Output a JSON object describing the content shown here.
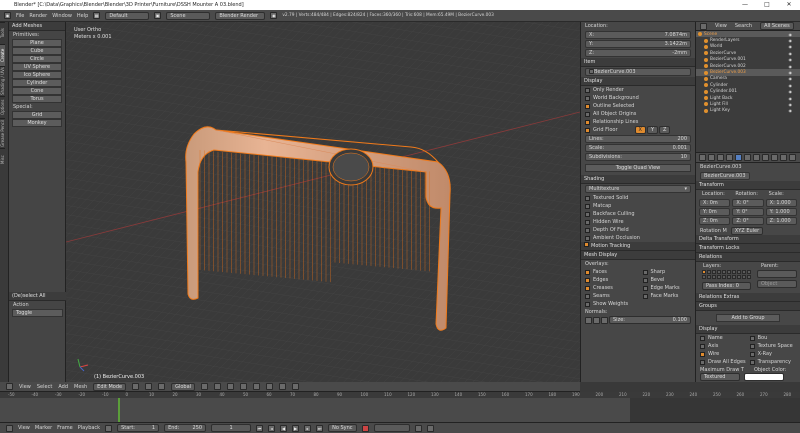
{
  "window": {
    "title": "Blender* [C:\\Data\\Graphics\\Blender\\Blender\\3D Printer\\Furniture\\DSSH Mounter A 03.blend]",
    "controls": [
      "—",
      "□",
      "✕"
    ]
  },
  "topmenu": {
    "items": [
      "File",
      "Render",
      "Window",
      "Help"
    ],
    "layout": "Default",
    "scene": "Scene",
    "engine": "Blender Render",
    "stats": "v2.79 | Verts:484/484 | Edges:824/824 | Faces:360/360 | Tris:608 | Mem:65.49M | BezierCurve.003"
  },
  "left_tabs": [
    "Tools",
    "Create",
    "Shading / UVs",
    "Options",
    "Grease Pencil",
    "Misc"
  ],
  "toolshelf": {
    "header": "Add Meshes",
    "section_primitives": "Primitives:",
    "primitives": [
      "Plane",
      "Cube",
      "Circle",
      "UV Sphere",
      "Ico Sphere",
      "Cylinder",
      "Cone",
      "Torus"
    ],
    "section_special": "Special:",
    "special": [
      "Grid",
      "Monkey"
    ],
    "op_header": "(De)select All",
    "op_action_label": "Action",
    "op_action_value": "Toggle"
  },
  "viewport": {
    "view_label": "User Ortho",
    "meters_label": "Meters x 0.001",
    "object_label": "(1) BezierCurve.003"
  },
  "properties_panel": {
    "location_label": "Location:",
    "location": [
      {
        "axis": "X:",
        "value": "7.0874m"
      },
      {
        "axis": "Y:",
        "value": "3.1422m"
      },
      {
        "axis": "Z:",
        "value": "-2mm"
      }
    ],
    "item_header": "Item",
    "item_name": "BezierCurve.003",
    "display_header": "Display",
    "display_options": [
      {
        "label": "Only Render",
        "checked": false
      },
      {
        "label": "World Background",
        "checked": false
      },
      {
        "label": "Outline Selected",
        "checked": true
      },
      {
        "label": "All Object Origins",
        "checked": false
      },
      {
        "label": "Relationship Lines",
        "checked": true
      }
    ],
    "grid_floor_label": "Grid Floor",
    "grid_axes": [
      "X",
      "Y",
      "Z"
    ],
    "grid_fields": [
      {
        "label": "Lines:",
        "value": "200"
      },
      {
        "label": "Scale:",
        "value": "0.001"
      },
      {
        "label": "Subdivisions:",
        "value": "10"
      }
    ],
    "toggle_quad": "Toggle Quad View",
    "shading_header": "Shading",
    "shading_mode": "Multitexture",
    "shading_options": [
      "Textured Solid",
      "Matcap",
      "Backface Culling",
      "Hidden Wire",
      "Depth Of Field",
      "Ambient Occlusion"
    ],
    "motion_tracking": "Motion Tracking",
    "mesh_display_header": "Mesh Display",
    "overlays_label": "Overlays:",
    "overlays_left": [
      {
        "label": "Faces",
        "checked": true
      },
      {
        "label": "Edges",
        "checked": true
      },
      {
        "label": "Creases",
        "checked": true
      },
      {
        "label": "Seams",
        "checked": false
      },
      {
        "label": "Show Weights",
        "checked": false
      }
    ],
    "overlays_right": [
      {
        "label": "Sharp",
        "checked": false
      },
      {
        "label": "Bevel",
        "checked": false
      },
      {
        "label": "Edge Marks",
        "checked": false
      },
      {
        "label": "Face Marks",
        "checked": false
      }
    ],
    "normals_label": "Normals:",
    "normals_size_label": "Size:",
    "normals_size_value": "0.100"
  },
  "outliner": {
    "tabs": [
      "View",
      "Search",
      "All Scenes"
    ],
    "rows": [
      {
        "name": "Scene",
        "indent": 0,
        "selected": true
      },
      {
        "name": "RenderLayers",
        "indent": 1,
        "selected": false
      },
      {
        "name": "World",
        "indent": 1,
        "selected": false
      },
      {
        "name": "BezierCurve",
        "indent": 1,
        "selected": false
      },
      {
        "name": "BezierCurve.001",
        "indent": 1,
        "selected": false
      },
      {
        "name": "BezierCurve.002",
        "indent": 1,
        "selected": false
      },
      {
        "name": "BezierCurve.003",
        "indent": 1,
        "selected": true
      },
      {
        "name": "Camera",
        "indent": 1,
        "selected": false
      },
      {
        "name": "Cylinder",
        "indent": 1,
        "selected": false
      },
      {
        "name": "Cylinder.001",
        "indent": 1,
        "selected": false
      },
      {
        "name": "Light Back",
        "indent": 1,
        "selected": false
      },
      {
        "name": "Light Fill",
        "indent": 1,
        "selected": false
      },
      {
        "name": "Light Key",
        "indent": 1,
        "selected": false
      }
    ]
  },
  "prop_editor": {
    "object_name": "BezierCurve.003",
    "object_field": "BezierCurve.003",
    "transform_header": "Transform",
    "loc_label": "Location:",
    "rot_label": "Rotation:",
    "scale_label": "Scale:",
    "loc": [
      "X: 0m",
      "Y: 0m",
      "Z: 0m"
    ],
    "rot": [
      "X: 0°",
      "Y: 0°",
      "Z: 0°"
    ],
    "scl": [
      "X: 1.000",
      "Y: 1.000",
      "Z: 1.000"
    ],
    "rotation_mode_label": "Rotation M",
    "rotation_mode": "XYZ Euler",
    "delta_header": "Delta Transform",
    "locks_header": "Transform Locks",
    "relations_header": "Relations",
    "layers_label": "Layers:",
    "parent_label": "Parent:",
    "object_label": "Object",
    "pass_index": "Pass Index: 0",
    "relations_extras": "Relations Extras",
    "groups_header": "Groups",
    "add_to_group": "Add to Group",
    "display_header": "Display",
    "display_left": [
      {
        "label": "Name",
        "checked": false
      },
      {
        "label": "Axis",
        "checked": false
      },
      {
        "label": "Wire",
        "checked": true
      },
      {
        "label": "Draw All Edges",
        "checked": false
      }
    ],
    "display_right": [
      {
        "label": "Bou",
        "checked": false
      },
      {
        "label": "Texture Space",
        "checked": false
      },
      {
        "label": "X-Ray",
        "checked": false
      },
      {
        "label": "Transparency",
        "checked": false
      }
    ],
    "max_draw_label": "Maximum Draw T",
    "object_color_label": "Object Color:",
    "max_draw_value": "Textured"
  },
  "view_header": {
    "items": [
      "View",
      "Select",
      "Add",
      "Mesh"
    ],
    "mode": "Edit Mode",
    "pivot": "Global"
  },
  "timeline": {
    "ticks": [
      "-50",
      "-40",
      "-30",
      "-20",
      "-10",
      "0",
      "10",
      "20",
      "30",
      "40",
      "50",
      "60",
      "70",
      "80",
      "90",
      "100",
      "110",
      "120",
      "130",
      "140",
      "150",
      "160",
      "170",
      "180",
      "190",
      "200",
      "210",
      "220",
      "230",
      "240",
      "250",
      "260",
      "270",
      "280"
    ],
    "menu": [
      "View",
      "Marker",
      "Frame",
      "Playback"
    ],
    "start_label": "Start:",
    "start_value": "1",
    "end_label": "End:",
    "end_value": "250",
    "current_frame": "1",
    "sync": "No Sync"
  },
  "colors": {
    "accent_orange": "#e08b2e",
    "selection_blue": "#5680c2",
    "panel_bg": "#474747"
  }
}
